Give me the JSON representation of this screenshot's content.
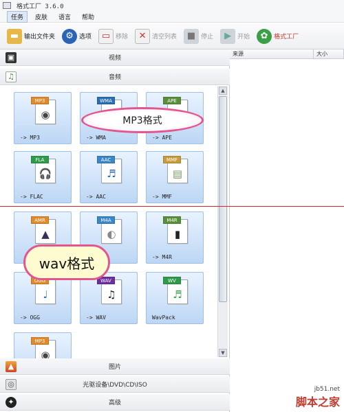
{
  "window": {
    "title": "格式工厂 3.6.0"
  },
  "menu": [
    "任务",
    "皮肤",
    "语言",
    "帮助"
  ],
  "toolbar": {
    "output_folder": "输出文件夹",
    "options": "选项",
    "remove": "移除",
    "clear_list": "清空列表",
    "stop": "停止",
    "start": "开始",
    "brand": "格式工厂"
  },
  "categories": {
    "video": "视频",
    "audio": "音频",
    "picture": "图片",
    "rom": "光驱设备\\DVD\\CD\\ISO",
    "advanced": "高级"
  },
  "tiles": [
    {
      "badge": "MP3",
      "label": "-> MP3",
      "badge_color": "#e28a2a",
      "glyph": "◉"
    },
    {
      "badge": "WMA",
      "label": "-> WMA",
      "badge_color": "#2b6fb3",
      "glyph": "♫"
    },
    {
      "badge": "APE",
      "label": "-> APE",
      "badge_color": "#5a8f3a",
      "glyph": "♪"
    },
    {
      "badge": "FLA",
      "label": "-> FLAC",
      "badge_color": "#2f9a4b",
      "glyph": "🎧"
    },
    {
      "badge": "AAC",
      "label": "-> AAC",
      "badge_color": "#3a86c9",
      "glyph": "♬"
    },
    {
      "badge": "MMF",
      "label": "-> MMF",
      "badge_color": "#c99a3a",
      "glyph": "▤"
    },
    {
      "badge": "AMR",
      "label": "",
      "badge_color": "#e28a2a",
      "glyph": "▲"
    },
    {
      "badge": "M4A",
      "label": "",
      "badge_color": "#3a86c9",
      "glyph": "◐"
    },
    {
      "badge": "M4R",
      "label": "-> M4R",
      "badge_color": "#5a8f3a",
      "glyph": "▮"
    },
    {
      "badge": "OGG",
      "label": "-> OGG",
      "badge_color": "#e28a2a",
      "glyph": "♩"
    },
    {
      "badge": "WAV",
      "label": "-> WAV",
      "badge_color": "#6b2fa0",
      "glyph": "♫"
    },
    {
      "badge": "WV",
      "label": "WavPack",
      "badge_color": "#2f9a4b",
      "glyph": "♬"
    },
    {
      "badge": "MP3",
      "label": "",
      "badge_color": "#e28a2a",
      "glyph": "◉"
    }
  ],
  "list_columns": [
    "来源",
    "大小"
  ],
  "callouts": {
    "mp3": "MP3格式",
    "wav": "wav格式"
  },
  "scroll": {
    "up": "▲",
    "down": "▼"
  },
  "watermark": {
    "url": "jb51.net",
    "name": "脚本之家"
  }
}
